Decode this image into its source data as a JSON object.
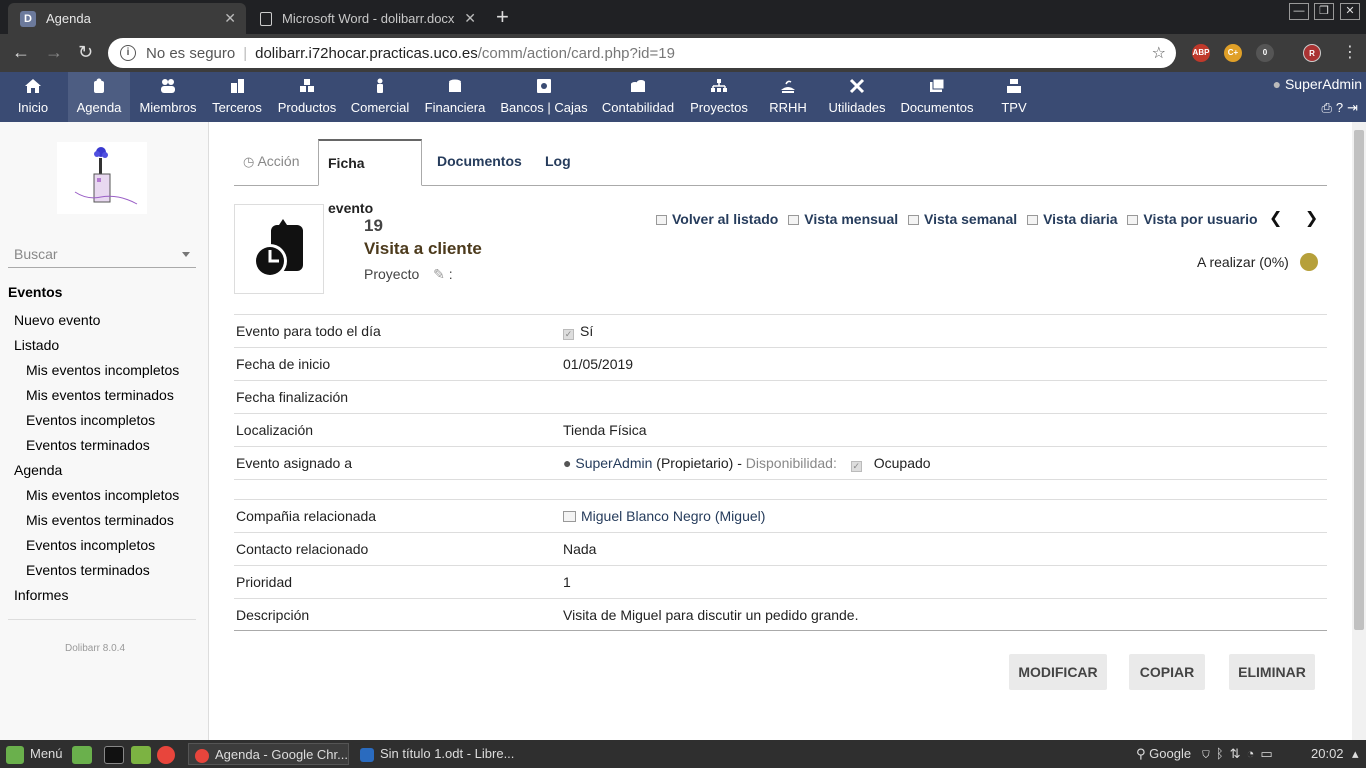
{
  "browser": {
    "tabs": [
      {
        "title": "Agenda",
        "favicon": "D"
      },
      {
        "title": "Microsoft Word - dolibarr.docx"
      }
    ],
    "url_security": "No es seguro",
    "url_host": "dolibarr.i72hocar.practicas.uco.es",
    "url_path": "/comm/action/card.php?id=19",
    "extensions": [
      "ABP",
      "C+",
      "0"
    ],
    "profile_initial": "R"
  },
  "topmenu": {
    "items": [
      "Inicio",
      "Agenda",
      "Miembros",
      "Terceros",
      "Productos",
      "Comercial",
      "Financiera",
      "Bancos | Cajas",
      "Contabilidad",
      "Proyectos",
      "RRHH",
      "Utilidades",
      "Documentos",
      "TPV"
    ],
    "selected": "Agenda",
    "user": "SuperAdmin"
  },
  "sidebar": {
    "search_placeholder": "Buscar",
    "menu": [
      {
        "label": "Eventos",
        "level": "head"
      },
      {
        "label": "Nuevo evento",
        "level": "l1"
      },
      {
        "label": "Listado",
        "level": "l1"
      },
      {
        "label": "Mis eventos incompletos",
        "level": "l2"
      },
      {
        "label": "Mis eventos terminados",
        "level": "l2"
      },
      {
        "label": "Eventos incompletos",
        "level": "l2"
      },
      {
        "label": "Eventos terminados",
        "level": "l2"
      },
      {
        "label": "Agenda",
        "level": "l1"
      },
      {
        "label": "Mis eventos incompletos",
        "level": "l2"
      },
      {
        "label": "Mis eventos terminados",
        "level": "l2"
      },
      {
        "label": "Eventos incompletos",
        "level": "l2"
      },
      {
        "label": "Eventos terminados",
        "level": "l2"
      },
      {
        "label": "Informes",
        "level": "l1"
      }
    ],
    "version": "Dolibarr 8.0.4"
  },
  "tabs": {
    "accion": "Acción",
    "ficha": "Ficha evento",
    "documentos": "Documentos",
    "log": "Log"
  },
  "event": {
    "ref": "19",
    "title": "Visita a cliente",
    "project_label": "Proyecto",
    "project_suffix": ":",
    "status": "A realizar (0%)",
    "status_color": "#b6a03a"
  },
  "nav": {
    "back": "Volver al listado",
    "monthly": "Vista mensual",
    "weekly": "Vista semanal",
    "daily": "Vista diaria",
    "byuser": "Vista por usuario"
  },
  "fields": {
    "allday_label": "Evento para todo el día",
    "allday_value": "Sí",
    "start_label": "Fecha de inicio",
    "start_value": "01/05/2019",
    "end_label": "Fecha finalización",
    "location_label": "Localización",
    "location_value": "Tienda Física",
    "assigned_label": "Evento asignado a",
    "assigned_user": "SuperAdmin",
    "assigned_role": "(Propietario) -",
    "availability_label": "Disponibilidad:",
    "availability_value": "Ocupado",
    "company_label": "Compañia relacionada",
    "company_value": "Miguel Blanco Negro (Miguel)",
    "contact_label": "Contacto relacionado",
    "contact_value": "Nada",
    "priority_label": "Prioridad",
    "priority_value": "1",
    "description_label": "Descripción",
    "description_value": "Visita de Miguel para discutir un pedido grande."
  },
  "buttons": {
    "modify": "MODIFICAR",
    "copy": "COPIAR",
    "delete": "ELIMINAR"
  },
  "taskbar": {
    "menu_label": "Menú",
    "windows": [
      "Agenda - Google Chr...",
      "Sin título 1.odt - Libre..."
    ],
    "search_label": "Google",
    "clock": "20:02"
  }
}
